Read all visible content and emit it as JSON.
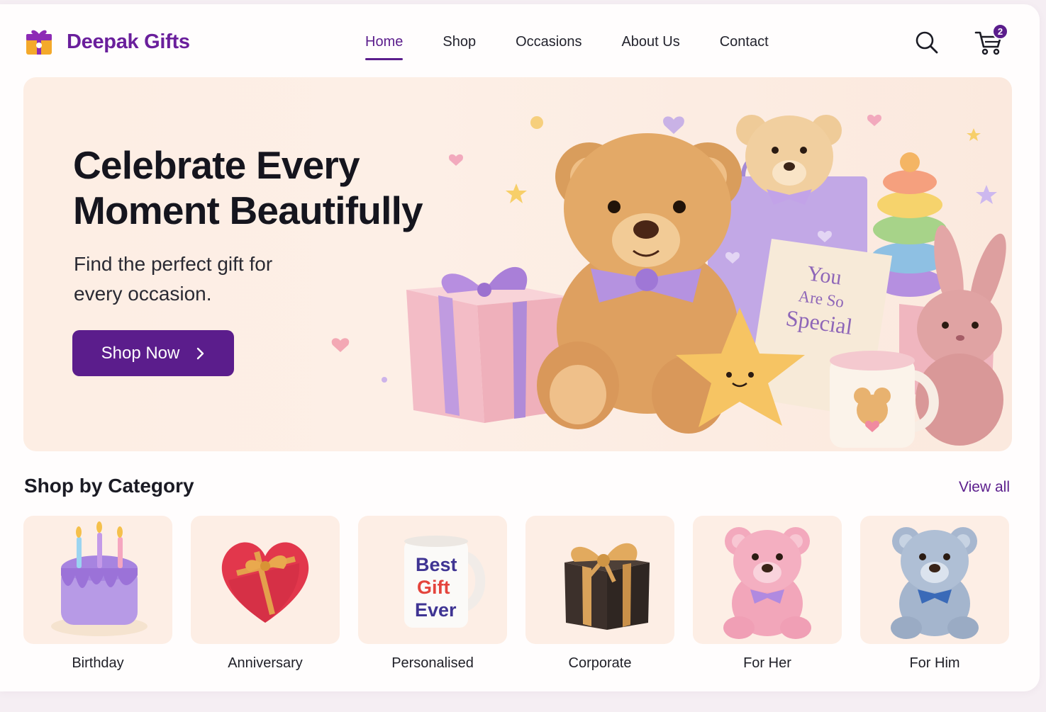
{
  "brand": {
    "name": "Deepak Gifts"
  },
  "nav": {
    "items": [
      {
        "label": "Home",
        "active": true
      },
      {
        "label": "Shop",
        "active": false
      },
      {
        "label": "Occasions",
        "active": false
      },
      {
        "label": "About Us",
        "active": false
      },
      {
        "label": "Contact",
        "active": false
      }
    ]
  },
  "header": {
    "cart_count": "2",
    "search_icon": "search-icon",
    "cart_icon": "cart-icon"
  },
  "hero": {
    "title_line1": "Celebrate Every",
    "title_line2": "Moment Beautifully",
    "subtitle": "Find the perfect gift for every occasion.",
    "cta_label": "Shop Now",
    "card_text": [
      "You",
      "Are So",
      "Special"
    ]
  },
  "categories": {
    "title": "Shop by Category",
    "view_all": "View all",
    "items": [
      {
        "label": "Birthday",
        "icon": "cake-icon"
      },
      {
        "label": "Anniversary",
        "icon": "heart-box-icon"
      },
      {
        "label": "Personalised",
        "icon": "mug-icon",
        "mug_text": [
          "Best",
          "Gift",
          "Ever"
        ]
      },
      {
        "label": "Corporate",
        "icon": "gift-box-icon"
      },
      {
        "label": "For Her",
        "icon": "pink-teddy-icon"
      },
      {
        "label": "For Him",
        "icon": "blue-teddy-icon"
      }
    ]
  },
  "colors": {
    "brand_purple": "#5b1d8c",
    "hero_bg": "#fdeee4",
    "tile_bg": "#fdeee5"
  }
}
